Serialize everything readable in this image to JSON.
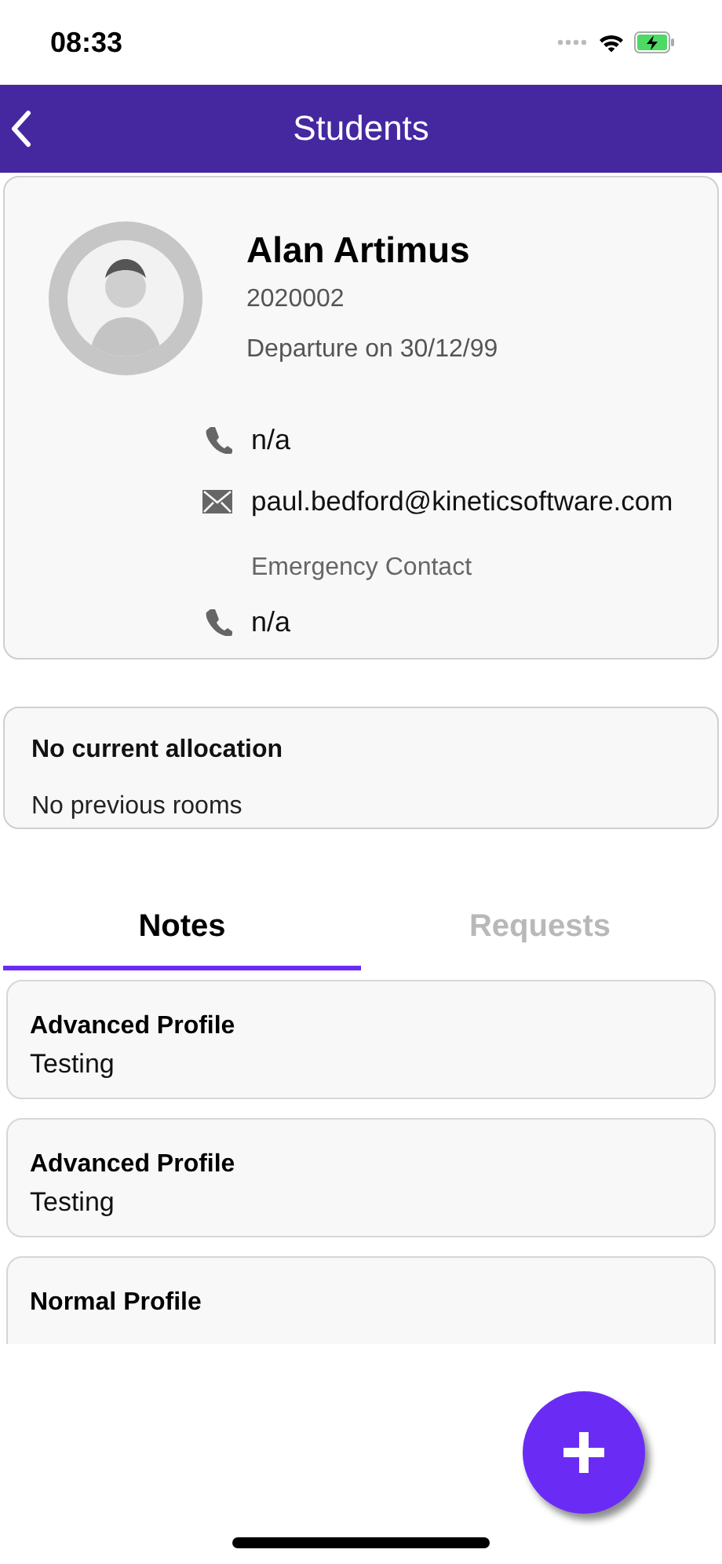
{
  "status_bar": {
    "time": "08:33"
  },
  "header": {
    "title": "Students"
  },
  "profile": {
    "name": "Alan Artimus",
    "id": "2020002",
    "departure": "Departure on 30/12/99",
    "contacts": [
      {
        "kind": "phone",
        "value": "n/a"
      },
      {
        "kind": "email",
        "value": "paul.bedford@kineticsoftware.com"
      },
      {
        "kind": "label",
        "value": "Emergency Contact"
      },
      {
        "kind": "phone",
        "value": "n/a"
      }
    ]
  },
  "allocation": {
    "title": "No current allocation",
    "subtitle": "No previous rooms"
  },
  "tabs": [
    {
      "label": "Notes",
      "selected": true
    },
    {
      "label": "Requests",
      "selected": false
    }
  ],
  "notes": [
    {
      "title": "Advanced Profile",
      "body": "Testing"
    },
    {
      "title": "Advanced Profile",
      "body": "Testing"
    },
    {
      "title": "Normal Profile"
    }
  ]
}
